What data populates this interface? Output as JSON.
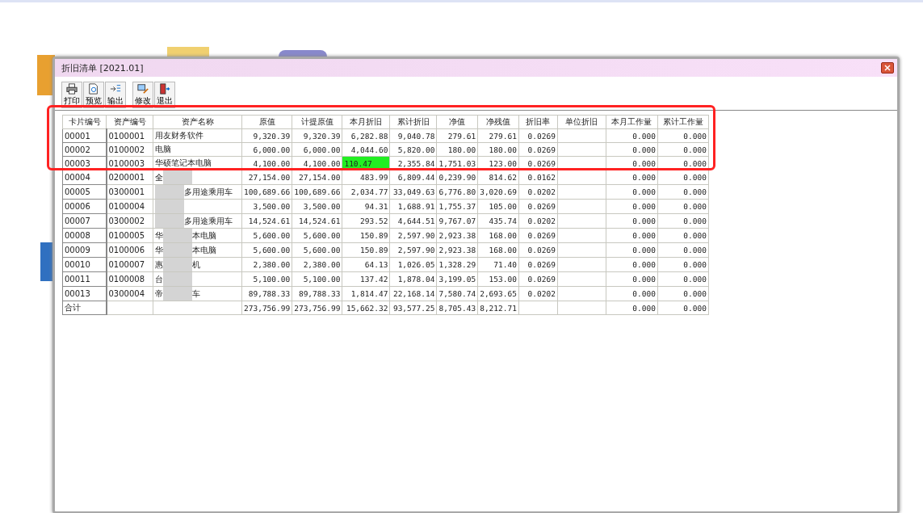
{
  "window": {
    "title": "折旧清单 [2021.01]"
  },
  "toolbar": [
    {
      "label": "打印",
      "kind": "print"
    },
    {
      "label": "预览",
      "kind": "preview"
    },
    {
      "label": "输出",
      "kind": "export"
    },
    {
      "label": "修改",
      "kind": "edit"
    },
    {
      "label": "退出",
      "kind": "exit"
    }
  ],
  "table": {
    "columns": [
      {
        "label": "卡片编号",
        "kind": "text"
      },
      {
        "label": "资产编号",
        "kind": "text"
      },
      {
        "label": "资产名称",
        "kind": "text"
      },
      {
        "label": "原值",
        "kind": "number"
      },
      {
        "label": "计提原值",
        "kind": "number"
      },
      {
        "label": "本月折旧",
        "kind": "number"
      },
      {
        "label": "累计折旧",
        "kind": "number"
      },
      {
        "label": "净值",
        "kind": "number"
      },
      {
        "label": "净残值",
        "kind": "number"
      },
      {
        "label": "折旧率",
        "kind": "number"
      },
      {
        "label": "单位折旧",
        "kind": "number"
      },
      {
        "label": "本月工作量",
        "kind": "number"
      },
      {
        "label": "累计工作量",
        "kind": "number"
      }
    ],
    "rows": [
      {
        "redacted": false,
        "editing": false,
        "card": "00001",
        "asset": "0100001",
        "name": "用友财务软件",
        "cost": "9,320.39",
        "base": "9,320.39",
        "month_dep": "6,282.88",
        "acc_dep": "9,040.78",
        "net": "279.61",
        "salvage": "279.61",
        "rate": "0.0269",
        "month_work": "0.000",
        "acc_work": "0.000"
      },
      {
        "redacted": false,
        "editing": false,
        "card": "00002",
        "asset": "0100002",
        "name": "电脑",
        "cost": "6,000.00",
        "base": "6,000.00",
        "month_dep": "4,044.60",
        "acc_dep": "5,820.00",
        "net": "180.00",
        "salvage": "180.00",
        "rate": "0.0269",
        "month_work": "0.000",
        "acc_work": "0.000"
      },
      {
        "redacted": false,
        "editing": true,
        "card": "00003",
        "asset": "0100003",
        "name": "华硕笔记本电脑",
        "cost": "4,100.00",
        "base": "4,100.00",
        "month_dep": "110.47",
        "acc_dep": "2,355.84",
        "net": "1,751.03",
        "salvage": "123.00",
        "rate": "0.0269",
        "month_work": "0.000",
        "acc_work": "0.000"
      },
      {
        "redacted": true,
        "editing": false,
        "card": "00004",
        "asset": "0200001",
        "name_start": "全",
        "cost": "27,154.00",
        "base": "27,154.00",
        "month_dep": "483.99",
        "acc_dep": "6,809.44",
        "net": "0,239.90",
        "salvage": "814.62",
        "rate": "0.0162",
        "month_work": "0.000",
        "acc_work": "0.000"
      },
      {
        "redacted": true,
        "editing": false,
        "card": "00005",
        "asset": "0300001",
        "name": "多用途乘用车",
        "cost": "100,689.66",
        "base": "100,689.66",
        "month_dep": "2,034.77",
        "acc_dep": "33,049.63",
        "net": "6,776.80",
        "salvage": "3,020.69",
        "rate": "0.0202",
        "month_work": "0.000",
        "acc_work": "0.000"
      },
      {
        "redacted": true,
        "editing": false,
        "card": "00006",
        "asset": "0100004",
        "cost": "3,500.00",
        "base": "3,500.00",
        "month_dep": "94.31",
        "acc_dep": "1,688.91",
        "net": "1,755.37",
        "salvage": "105.00",
        "rate": "0.0269",
        "month_work": "0.000",
        "acc_work": "0.000"
      },
      {
        "redacted": true,
        "editing": false,
        "card": "00007",
        "asset": "0300002",
        "name": "多用途乘用车",
        "cost": "14,524.61",
        "base": "14,524.61",
        "month_dep": "293.52",
        "acc_dep": "4,644.51",
        "net": "9,767.07",
        "salvage": "435.74",
        "rate": "0.0202",
        "month_work": "0.000",
        "acc_work": "0.000"
      },
      {
        "redacted": true,
        "editing": false,
        "card": "00008",
        "asset": "0100005",
        "name_start": "华",
        "name": "本电脑",
        "cost": "5,600.00",
        "base": "5,600.00",
        "month_dep": "150.89",
        "acc_dep": "2,597.90",
        "net": "2,923.38",
        "salvage": "168.00",
        "rate": "0.0269",
        "month_work": "0.000",
        "acc_work": "0.000"
      },
      {
        "redacted": true,
        "editing": false,
        "card": "00009",
        "asset": "0100006",
        "name_start": "华",
        "name": "本电脑",
        "cost": "5,600.00",
        "base": "5,600.00",
        "month_dep": "150.89",
        "acc_dep": "2,597.90",
        "net": "2,923.38",
        "salvage": "168.00",
        "rate": "0.0269",
        "month_work": "0.000",
        "acc_work": "0.000"
      },
      {
        "redacted": true,
        "editing": false,
        "card": "00010",
        "asset": "0100007",
        "name_start": "惠",
        "name": "机",
        "cost": "2,380.00",
        "base": "2,380.00",
        "month_dep": "64.13",
        "acc_dep": "1,026.05",
        "net": "1,328.29",
        "salvage": "71.40",
        "rate": "0.0269",
        "month_work": "0.000",
        "acc_work": "0.000"
      },
      {
        "redacted": true,
        "editing": false,
        "card": "00011",
        "asset": "0100008",
        "name_start": "台",
        "cost": "5,100.00",
        "base": "5,100.00",
        "month_dep": "137.42",
        "acc_dep": "1,878.04",
        "net": "3,199.05",
        "salvage": "153.00",
        "rate": "0.0269",
        "month_work": "0.000",
        "acc_work": "0.000"
      },
      {
        "redacted": true,
        "editing": false,
        "card": "00013",
        "asset": "0300004",
        "name_start": "帝",
        "name": "车",
        "cost": "89,788.33",
        "base": "89,788.33",
        "month_dep": "1,814.47",
        "acc_dep": "22,168.14",
        "net": "7,580.74",
        "salvage": "2,693.65",
        "rate": "0.0202",
        "month_work": "0.000",
        "acc_work": "0.000"
      }
    ],
    "total": {
      "card": "合计",
      "cost": "273,756.99",
      "base": "273,756.99",
      "month_dep": "15,662.32",
      "acc_dep": "93,577.25",
      "net": "8,705.43",
      "salvage": "8,212.71",
      "month_work": "0.000",
      "acc_work": "0.000"
    }
  }
}
